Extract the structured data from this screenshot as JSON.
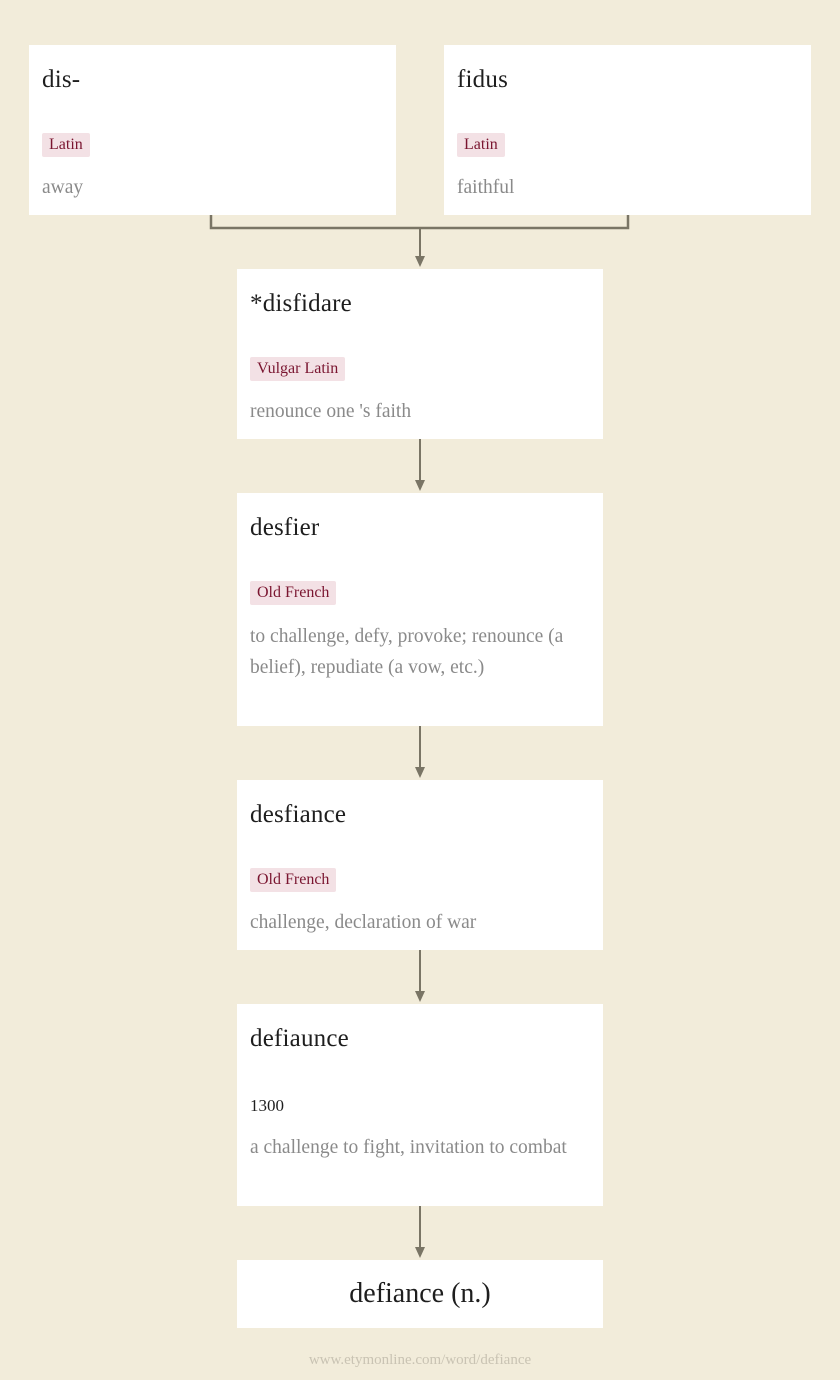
{
  "nodes": [
    {
      "id": "dis",
      "word": "dis-",
      "language": "Latin",
      "gloss": "away"
    },
    {
      "id": "fidus",
      "word": "fidus",
      "language": "Latin",
      "gloss": "faithful"
    },
    {
      "id": "disfidare",
      "word": "*disfidare",
      "language": "Vulgar Latin",
      "gloss": "renounce one 's faith"
    },
    {
      "id": "desfier",
      "word": "desfier",
      "language": "Old French",
      "gloss": "to challenge, defy, provoke; renounce (a belief), repudiate (a vow, etc.)"
    },
    {
      "id": "desfiance",
      "word": "desfiance",
      "language": "Old French",
      "gloss": "challenge, declaration of war"
    },
    {
      "id": "defiaunce",
      "word": "defiaunce",
      "year": "1300",
      "gloss": "a challenge to fight, invitation to combat"
    }
  ],
  "final": {
    "word": "defiance (n.)"
  },
  "edges": [
    [
      "dis",
      "disfidare"
    ],
    [
      "fidus",
      "disfidare"
    ],
    [
      "disfidare",
      "desfier"
    ],
    [
      "desfier",
      "desfiance"
    ],
    [
      "desfiance",
      "defiaunce"
    ],
    [
      "defiaunce",
      "final"
    ]
  ],
  "colors": {
    "background": "#f2ecda",
    "language_tag_bg": "#f3e1e5",
    "language_tag_text": "#7a1530",
    "arrow": "#7a7565"
  },
  "footer": "www.etymonline.com/word/defiance"
}
